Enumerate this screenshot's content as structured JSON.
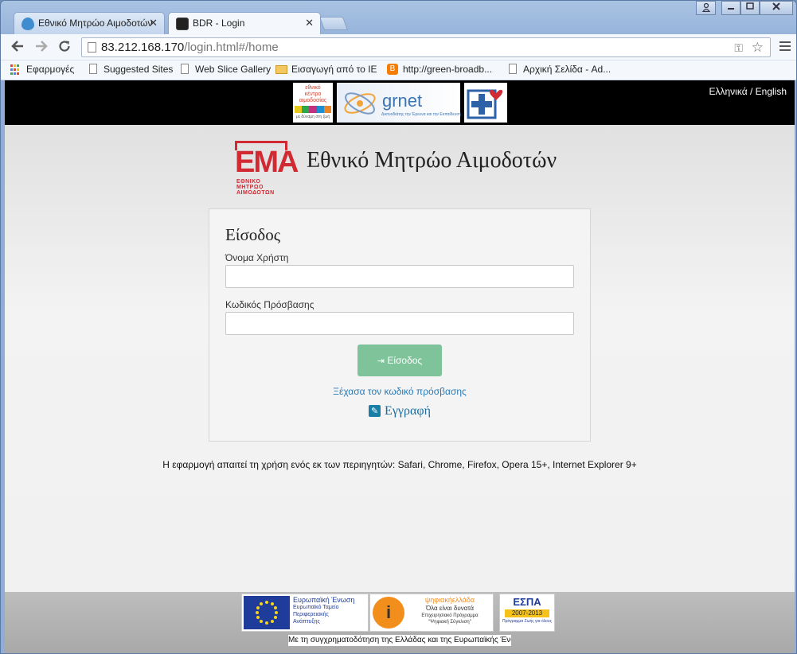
{
  "browser": {
    "tabs": [
      {
        "title": "Εθνικό Μητρώο Αιμοδοτών",
        "favicon": "drupal-icon"
      },
      {
        "title": "BDR - Login",
        "favicon": "ema-icon"
      }
    ],
    "url": {
      "host": "83.212.168.170",
      "path": "/login.html#/home"
    },
    "bookmarks": [
      {
        "label": "Εφαρμογές",
        "icon": "apps-icon"
      },
      {
        "label": "Suggested Sites",
        "icon": "page-icon"
      },
      {
        "label": "Web Slice Gallery",
        "icon": "page-icon"
      },
      {
        "label": "Εισαγωγή από το IE",
        "icon": "folder-icon"
      },
      {
        "label": "http://green-broadb...",
        "icon": "blogger-icon"
      },
      {
        "label": "Αρχική Σελίδα - Ad...",
        "icon": "page-icon"
      }
    ]
  },
  "header": {
    "logos": {
      "ekea_lines": [
        "εθνικό",
        "κέντρο",
        "αιμοδοσίας",
        "με δύναμη στη ζωή"
      ],
      "grnet": "grnet",
      "grnet_caption": "Δικτυοδιάτης την Έρευνα και την Εκπαίδευση"
    },
    "language_switch": "Ελληνικά / English"
  },
  "brand": {
    "logo_text": "ΕΜΑ",
    "logo_sub_lines": [
      "ΕΘΝΙΚΟ ΜΗΤΡΩΟ",
      "ΑΙΜΟΔΟΤΩΝ"
    ],
    "title": "Εθνικό Μητρώο Αιμοδοτών"
  },
  "login": {
    "heading": "Είσοδος",
    "username_label": "Όνομα Χρήστη",
    "username_value": "",
    "password_label": "Κωδικός Πρόσβασης",
    "password_value": "",
    "submit_label": "Είσοδος",
    "forgot_label": "Ξέχασα τον κωδικό πρόσβασης",
    "register_label": "Εγγραφή"
  },
  "browser_note": "Η εφαρμογή απαιτεί τη χρήση ενός εκ των περιηγητών: Safari, Chrome, Firefox, Opera 15+, Internet Explorer 9+",
  "footer": {
    "eu_lines": [
      "Ευρωπαϊκή Ένωση",
      "Ευρωπαϊκό Ταμείο",
      "Περιφερειακής",
      "Ανάπτυξης"
    ],
    "digital_lines": [
      "ψηφιακήελλάδα",
      "Όλα είναι δυνατά",
      "Επιχειρησιακό Πρόγραμμα",
      "\"Ψηφιακή Σύγκλιση\""
    ],
    "espa_lines": [
      "ΕΣΠΑ",
      "2007-2013",
      "Πρόγραμμα Ζωής για όλους"
    ],
    "note": "Με τη συγχρηματοδότηση της Ελλάδας και της Ευρωπαϊκής Ένωσης"
  },
  "colors": {
    "brand_red": "#d22a33",
    "button_green": "#7fc39a",
    "link_blue": "#2a7ab5"
  }
}
